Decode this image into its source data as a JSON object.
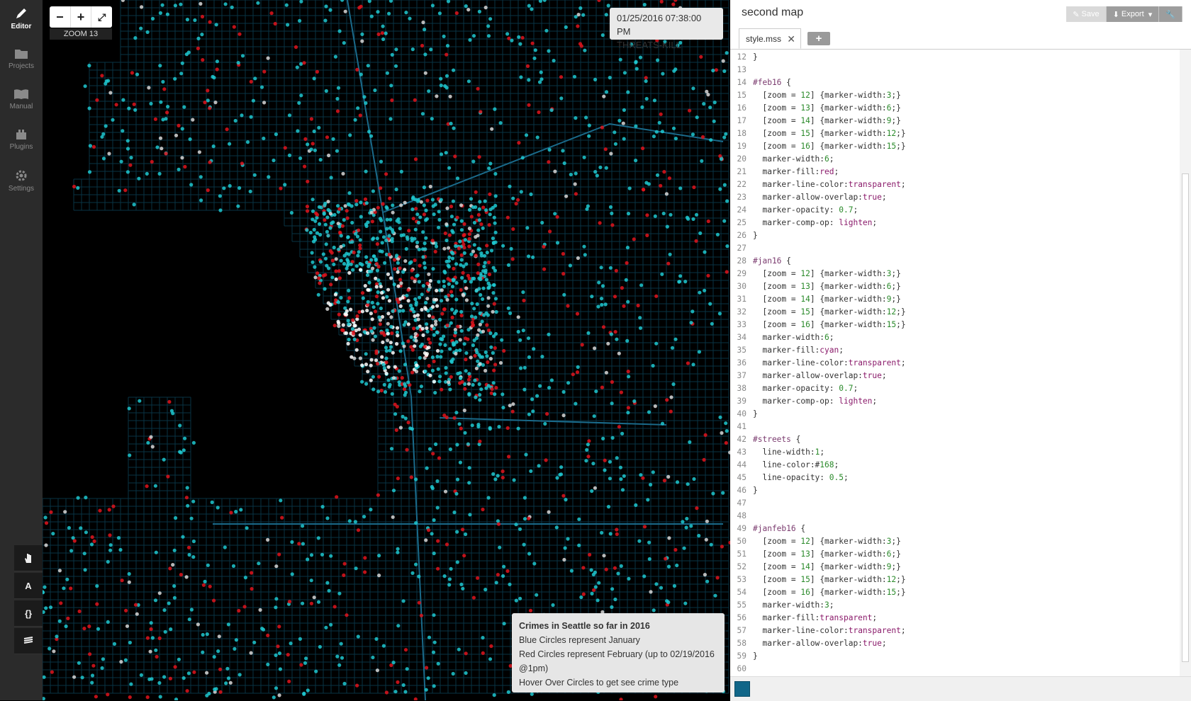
{
  "sidebar": {
    "items": [
      {
        "label": "Editor",
        "icon": "pencil-icon"
      },
      {
        "label": "Projects",
        "icon": "folder-icon"
      },
      {
        "label": "Manual",
        "icon": "book-icon"
      },
      {
        "label": "Plugins",
        "icon": "plugin-icon"
      },
      {
        "label": "Settings",
        "icon": "gear-icon"
      }
    ],
    "tools": [
      {
        "label": "",
        "icon": "hand-icon"
      },
      {
        "label": "A",
        "icon": "font-icon"
      },
      {
        "label": "{}",
        "icon": "braces-icon"
      },
      {
        "label": "",
        "icon": "layers-icon"
      }
    ]
  },
  "map": {
    "zoom_label": "ZOOM 13",
    "tooltip": {
      "date": "01/25/2016 07:38:00 PM",
      "type": "THREATS-KILL"
    },
    "legend": {
      "title": "Crimes in Seattle so far in 2016",
      "lines": [
        "Blue Circles represent January",
        "Red Circles represent February (up to 02/19/2016 @1pm)",
        "Hover Over Circles to get see crime type"
      ]
    },
    "colors": {
      "january": "#1fc8d0",
      "february": "#e0141c",
      "streets": "#168"
    }
  },
  "editor": {
    "project_title": "second map",
    "actions": {
      "save": "Save",
      "export": "Export"
    },
    "tab": {
      "name": "style.mss",
      "add": "+"
    },
    "code_lines": [
      {
        "n": "12",
        "t": "}"
      },
      {
        "n": "13",
        "t": ""
      },
      {
        "n": "14",
        "t": "#feb16 {"
      },
      {
        "n": "15",
        "t": "  [zoom = 12] {marker-width:3;}"
      },
      {
        "n": "16",
        "t": "  [zoom = 13] {marker-width:6;}"
      },
      {
        "n": "17",
        "t": "  [zoom = 14] {marker-width:9;}"
      },
      {
        "n": "18",
        "t": "  [zoom = 15] {marker-width:12;}"
      },
      {
        "n": "19",
        "t": "  [zoom = 16] {marker-width:15;}"
      },
      {
        "n": "20",
        "t": "  marker-width:6;"
      },
      {
        "n": "21",
        "t": "  marker-fill:red;"
      },
      {
        "n": "22",
        "t": "  marker-line-color:transparent;"
      },
      {
        "n": "23",
        "t": "  marker-allow-overlap:true;"
      },
      {
        "n": "24",
        "t": "  marker-opacity: 0.7;"
      },
      {
        "n": "25",
        "t": "  marker-comp-op: lighten;"
      },
      {
        "n": "26",
        "t": "}"
      },
      {
        "n": "27",
        "t": ""
      },
      {
        "n": "28",
        "t": "#jan16 {"
      },
      {
        "n": "29",
        "t": "  [zoom = 12] {marker-width:3;}"
      },
      {
        "n": "30",
        "t": "  [zoom = 13] {marker-width:6;}"
      },
      {
        "n": "31",
        "t": "  [zoom = 14] {marker-width:9;}"
      },
      {
        "n": "32",
        "t": "  [zoom = 15] {marker-width:12;}"
      },
      {
        "n": "33",
        "t": "  [zoom = 16] {marker-width:15;}"
      },
      {
        "n": "34",
        "t": "  marker-width:6;"
      },
      {
        "n": "35",
        "t": "  marker-fill:cyan;"
      },
      {
        "n": "36",
        "t": "  marker-line-color:transparent;"
      },
      {
        "n": "37",
        "t": "  marker-allow-overlap:true;"
      },
      {
        "n": "38",
        "t": "  marker-opacity: 0.7;"
      },
      {
        "n": "39",
        "t": "  marker-comp-op: lighten;"
      },
      {
        "n": "40",
        "t": "}"
      },
      {
        "n": "41",
        "t": ""
      },
      {
        "n": "42",
        "t": "#streets {"
      },
      {
        "n": "43",
        "t": "  line-width:1;"
      },
      {
        "n": "44",
        "t": "  line-color:#168;"
      },
      {
        "n": "45",
        "t": "  line-opacity: 0.5;"
      },
      {
        "n": "46",
        "t": "}"
      },
      {
        "n": "47",
        "t": ""
      },
      {
        "n": "48",
        "t": ""
      },
      {
        "n": "49",
        "t": "#janfeb16 {"
      },
      {
        "n": "50",
        "t": "  [zoom = 12] {marker-width:3;}"
      },
      {
        "n": "51",
        "t": "  [zoom = 13] {marker-width:6;}"
      },
      {
        "n": "52",
        "t": "  [zoom = 14] {marker-width:9;}"
      },
      {
        "n": "53",
        "t": "  [zoom = 15] {marker-width:12;}"
      },
      {
        "n": "54",
        "t": "  [zoom = 16] {marker-width:15;}"
      },
      {
        "n": "55",
        "t": "  marker-width:3;"
      },
      {
        "n": "56",
        "t": "  marker-fill:transparent;"
      },
      {
        "n": "57",
        "t": "  marker-line-color:transparent;"
      },
      {
        "n": "58",
        "t": "  marker-allow-overlap:true;"
      },
      {
        "n": "59",
        "t": "}"
      },
      {
        "n": "60",
        "t": ""
      }
    ]
  }
}
